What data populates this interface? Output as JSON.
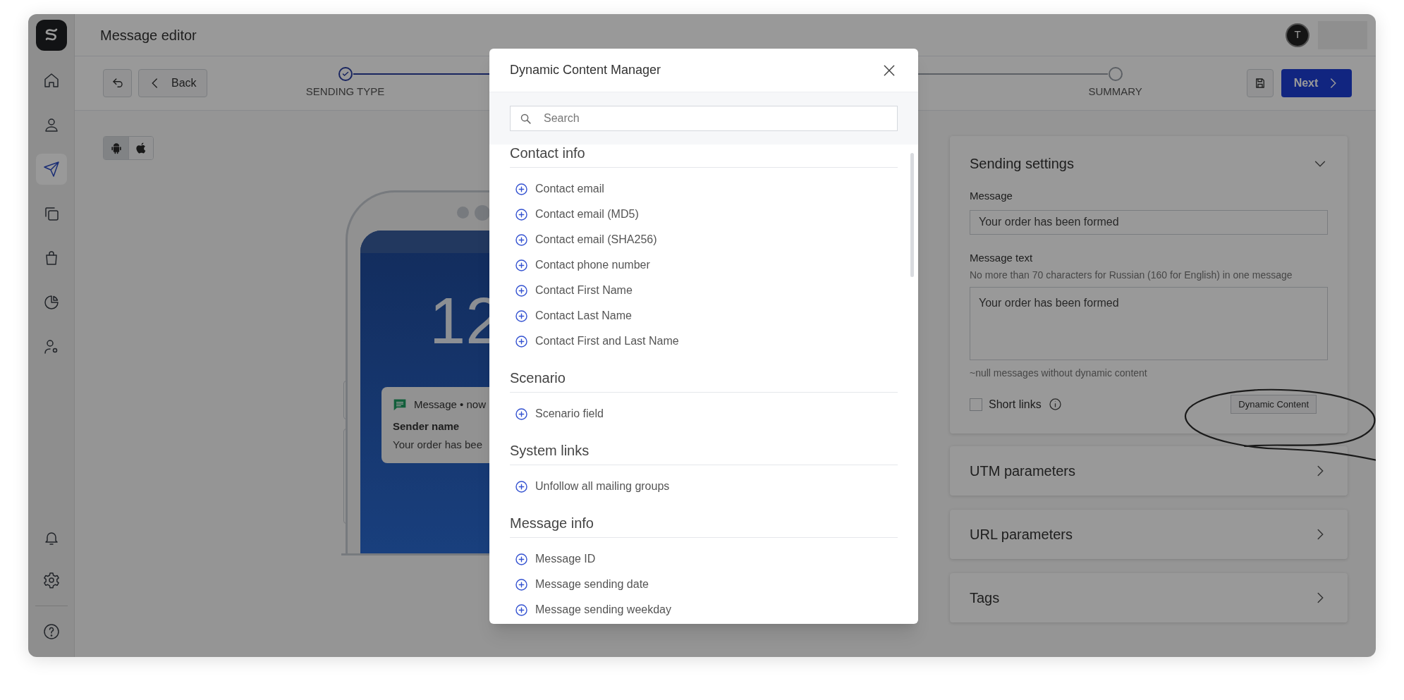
{
  "app": {
    "title": "Message editor",
    "avatar": "T"
  },
  "sidebar": {
    "top": [
      {
        "kind": "home",
        "selected": false
      },
      {
        "kind": "user",
        "selected": false
      },
      {
        "kind": "send",
        "selected": true
      },
      {
        "kind": "copy",
        "selected": false
      },
      {
        "kind": "bag",
        "selected": false
      },
      {
        "kind": "chart",
        "selected": false
      },
      {
        "kind": "user-settings",
        "selected": false
      }
    ],
    "bottom": [
      {
        "kind": "bell",
        "selected": false
      },
      {
        "kind": "settings",
        "selected": false
      },
      {
        "kind": "help",
        "selected": false
      }
    ]
  },
  "toolbar": {
    "back": "Back",
    "steps": [
      {
        "label": "SENDING TYPE",
        "done": true
      },
      {
        "label": "SUMMARY",
        "done": false
      }
    ],
    "next": "Next"
  },
  "platforms": [
    {
      "kind": "android",
      "selected": true
    },
    {
      "kind": "apple",
      "selected": false
    }
  ],
  "preview": {
    "time": "12",
    "app": "Message • now",
    "sender": "Sender name",
    "text": "Your order has bee"
  },
  "settings": {
    "title": "Sending settings",
    "expanded": true,
    "message_label": "Message",
    "message_value": "Your order has been formed",
    "text_label": "Message text",
    "text_hint": "No more than 70 characters for Russian (160 for English) in one message",
    "text_value": "Your order has been formed",
    "counter": "~null messages without dynamic content",
    "short_links": {
      "label": "Short links",
      "checked": false
    },
    "dynamic_button": "Dynamic Content"
  },
  "panels": [
    {
      "title": "UTM parameters",
      "expanded": false
    },
    {
      "title": "URL parameters",
      "expanded": false
    },
    {
      "title": "Tags",
      "expanded": false
    }
  ],
  "modal": {
    "title": "Dynamic Content Manager",
    "search_placeholder": "Search",
    "groups": [
      {
        "title": "Contact info",
        "items": [
          "Contact email",
          "Contact email (MD5)",
          "Contact email (SHA256)",
          "Contact phone number",
          "Contact First Name",
          "Contact Last Name",
          "Contact First and Last Name"
        ]
      },
      {
        "title": "Scenario",
        "items": [
          "Scenario field"
        ]
      },
      {
        "title": "System links",
        "items": [
          "Unfollow all mailing groups"
        ]
      },
      {
        "title": "Message info",
        "items": [
          "Message ID",
          "Message sending date",
          "Message sending weekday"
        ]
      }
    ]
  }
}
